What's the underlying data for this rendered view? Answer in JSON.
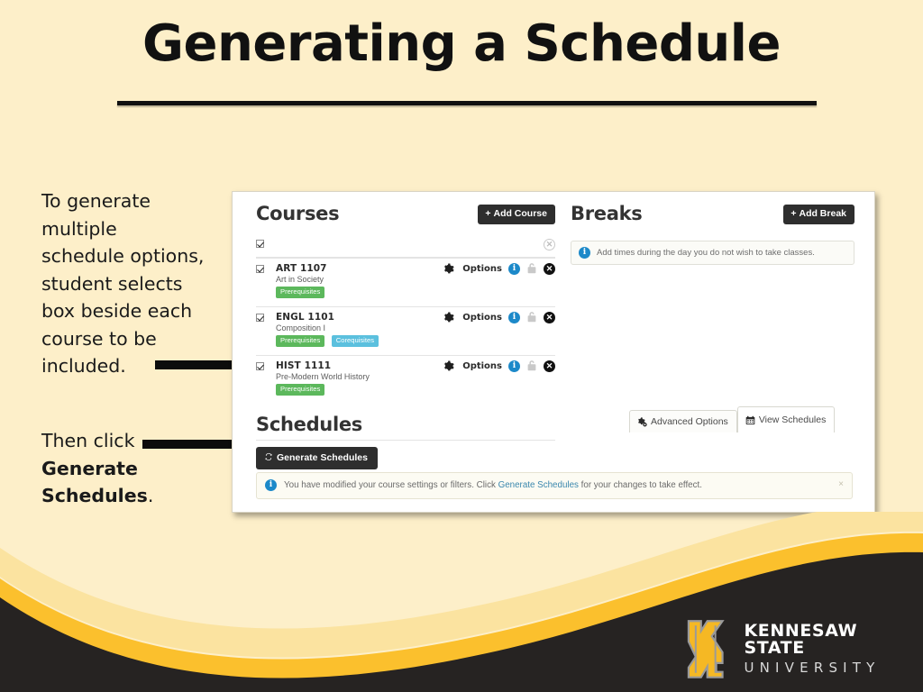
{
  "slide": {
    "title": "Generating a Schedule",
    "background_color": "#fdefc9"
  },
  "captions": {
    "first_line1": "To generate",
    "first_line2": "multiple",
    "first_line3": "schedule options,",
    "first_line4": "student selects",
    "first_line5": "box beside each",
    "first_line6": "course to be",
    "first_line7": "included.",
    "second_prefix": "Then click ",
    "second_bold1": "Generate",
    "second_bold2": "Schedules",
    "second_suffix": "."
  },
  "app": {
    "courses": {
      "title": "Courses",
      "add_button": "Add Course",
      "add_button_plus": "+",
      "header_row": {
        "checked": true,
        "remove_icon": "x-circle-icon"
      },
      "options_label": "Options",
      "rows": [
        {
          "code": "ART 1107",
          "name": "Art in Society",
          "checked": true,
          "badges": [
            "Prerequisites"
          ]
        },
        {
          "code": "ENGL 1101",
          "name": "Composition I",
          "checked": true,
          "badges": [
            "Prerequisites",
            "Corequisites"
          ]
        },
        {
          "code": "HIST 1111",
          "name": "Pre-Modern World History",
          "checked": true,
          "badges": [
            "Prerequisites"
          ]
        }
      ]
    },
    "breaks": {
      "title": "Breaks",
      "add_button": "Add Break",
      "add_button_plus": "+",
      "info_text": "Add times during the day you do not wish to take classes."
    },
    "schedules": {
      "title": "Schedules",
      "generate_button": "Generate Schedules"
    },
    "tabs": [
      {
        "label": "Advanced Options",
        "icon": "gears-icon",
        "active": false
      },
      {
        "label": "View Schedules",
        "icon": "calendar-icon",
        "active": true
      }
    ],
    "notification": {
      "text_before": "You have modified your course settings or filters. Click ",
      "link_text": "Generate Schedules",
      "text_after": " for your changes to take effect.",
      "close_label": "×"
    },
    "colors": {
      "prereq_badge": "#5cb85c",
      "coreq_badge": "#5bc0de",
      "info_blue": "#1c89c9",
      "dark_button": "#2e2e2e",
      "link": "#3a87ad"
    }
  },
  "footer": {
    "logo_line1": "KENNESAW STATE",
    "logo_line2": "UNIVERSITY",
    "wave_gold": "#fbc02d",
    "wave_cream": "#fbe3a0",
    "wave_dark": "#262322"
  }
}
